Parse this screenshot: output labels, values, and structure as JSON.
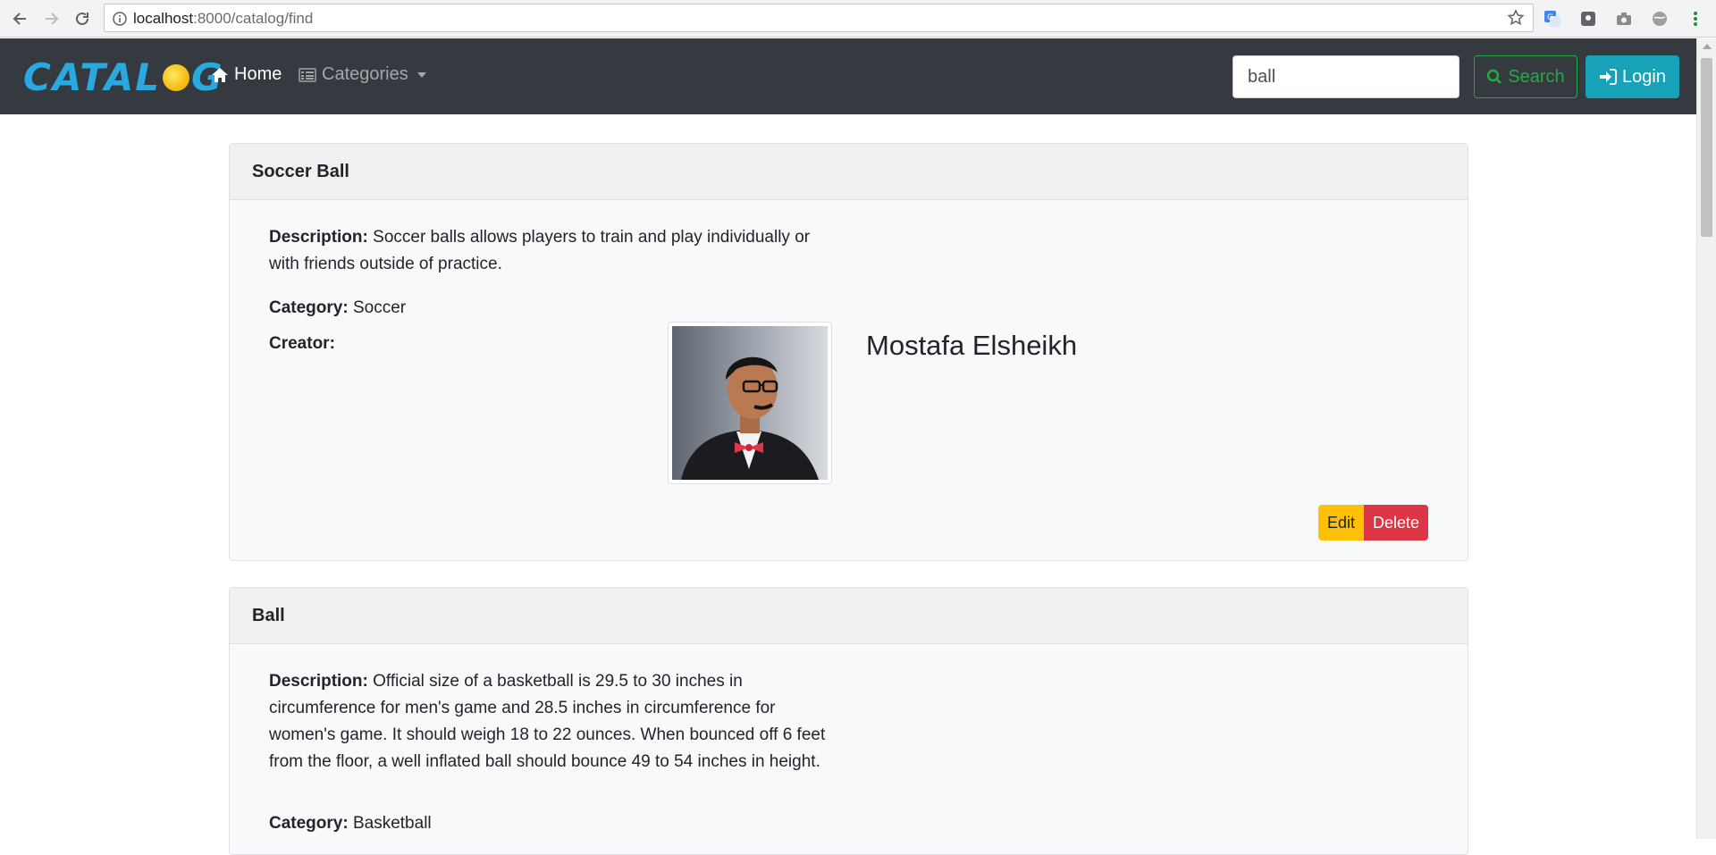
{
  "browser": {
    "url_host": "localhost",
    "url_path": ":8000/catalog/find"
  },
  "navbar": {
    "brand_left": "CATAL",
    "brand_right": "G",
    "home_label": "Home",
    "categories_label": "Categories",
    "search_value": "ball",
    "search_button": "Search",
    "login_button": "Login"
  },
  "items": [
    {
      "title": "Soccer Ball",
      "description_label": "Description:",
      "description": "Soccer balls allows players to train and play individually or with friends outside of practice.",
      "category_label": "Category:",
      "category": "Soccer",
      "creator_label": "Creator:",
      "creator_name": "Mostafa Elsheikh",
      "edit_label": "Edit",
      "delete_label": "Delete"
    },
    {
      "title": "Ball",
      "description_label": "Description:",
      "description": "Official size of a basketball is 29.5 to 30 inches in circumference for men's game and 28.5 inches in circumference for women's game. It should weigh 18 to 22 ounces. When bounced off 6 feet from the floor, a well inflated ball should bounce 49 to 54 inches in height.",
      "category_label": "Category:",
      "category": "Basketball"
    }
  ]
}
